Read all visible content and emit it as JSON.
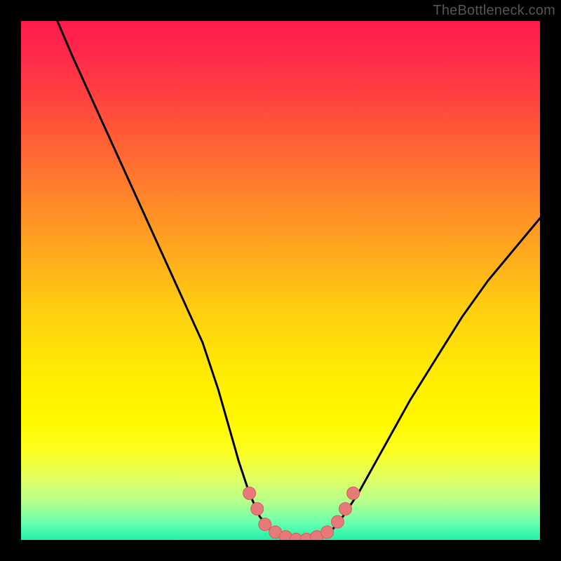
{
  "watermark": "TheBottleneck.com",
  "colors": {
    "curve": "#000000",
    "marker_fill": "#e67a78",
    "marker_stroke": "#d85c58"
  },
  "chart_data": {
    "type": "line",
    "title": "",
    "xlabel": "",
    "ylabel": "",
    "xlim": [
      0,
      100
    ],
    "ylim": [
      0,
      100
    ],
    "grid": false,
    "legend": false,
    "series": [
      {
        "name": "bottleneck-curve",
        "x": [
          7,
          10,
          15,
          20,
          25,
          30,
          35,
          38,
          40,
          42,
          44,
          46,
          48,
          50,
          52,
          54,
          56,
          58,
          60,
          62,
          65,
          70,
          75,
          80,
          85,
          90,
          95,
          100
        ],
        "y": [
          100,
          93,
          82,
          71,
          60,
          49,
          38,
          29,
          22,
          15,
          9,
          4.5,
          2,
          0.9,
          0.3,
          0.0,
          0.3,
          0.9,
          2,
          4.5,
          9,
          18,
          27,
          35,
          43,
          50,
          56,
          62
        ]
      }
    ],
    "markers": [
      {
        "x": 44,
        "y": 9
      },
      {
        "x": 45.5,
        "y": 6
      },
      {
        "x": 47,
        "y": 3
      },
      {
        "x": 49,
        "y": 1.5
      },
      {
        "x": 51,
        "y": 0.6
      },
      {
        "x": 53,
        "y": 0.1
      },
      {
        "x": 55,
        "y": 0.1
      },
      {
        "x": 57,
        "y": 0.6
      },
      {
        "x": 59,
        "y": 1.5
      },
      {
        "x": 61,
        "y": 3.5
      },
      {
        "x": 62.5,
        "y": 6
      },
      {
        "x": 64,
        "y": 9
      }
    ]
  }
}
